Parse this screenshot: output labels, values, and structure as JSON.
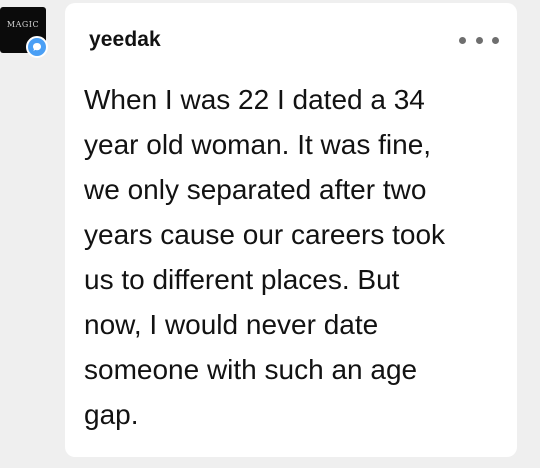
{
  "avatar": {
    "text": "MAGIC",
    "badge_icon": "chat-bubble-icon"
  },
  "post": {
    "username": "yeedak",
    "menu_icon": "more-horizontal-icon",
    "message_lines": [
      "When I was 22 I dated a 34",
      "year old woman. It was fine,",
      "we only separated after two",
      "years cause our careers took",
      "us to different places. But",
      "now, I would never date",
      "someone with such an age",
      "gap."
    ]
  },
  "colors": {
    "background": "#efefef",
    "card": "#ffffff",
    "badge": "#4a9ff5",
    "text": "#121212"
  }
}
